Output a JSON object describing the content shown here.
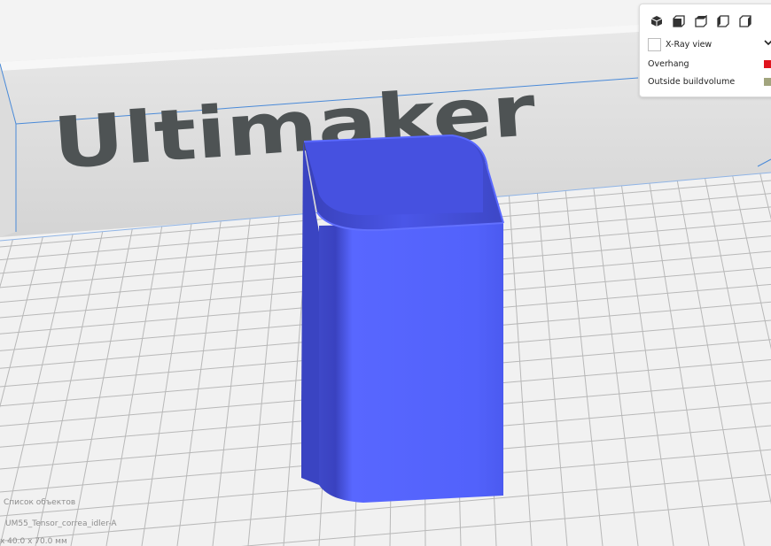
{
  "viewport": {
    "brand_text": "Ultimaker",
    "colors": {
      "background": "#f3f3f3",
      "build_plate": "#f1f1f1",
      "grid_line": "#b8b8b8",
      "wall": "#d9d9d9",
      "outline": "#4a8ad8",
      "model": "#4b5cf5",
      "brand_text": "#4e5354"
    }
  },
  "view_panel": {
    "view_buttons": [
      {
        "icon": "3d-view-icon"
      },
      {
        "icon": "front-view-icon"
      },
      {
        "icon": "top-view-icon"
      },
      {
        "icon": "left-view-icon"
      },
      {
        "icon": "right-view-icon"
      }
    ],
    "xray_label": "X-Ray view",
    "overhang_label": "Overhang",
    "overhang_color": "#e0141e",
    "outside_label": "Outside buildvolume",
    "outside_color": "#a2a57e"
  },
  "object_list": {
    "title": "Список объектов",
    "item_name": "UM55_Tensor_correa_idler-A",
    "dimensions": "x 40.0 x 70.0 мм"
  }
}
